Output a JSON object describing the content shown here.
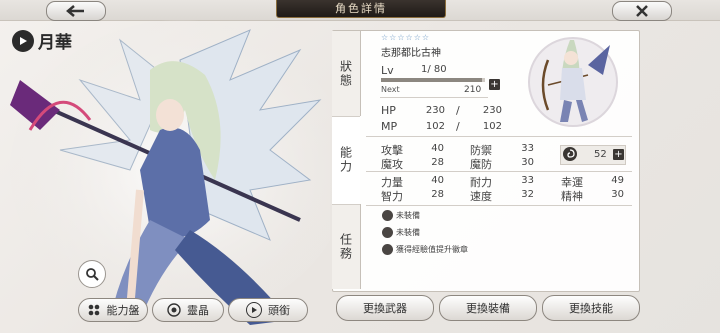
{
  "header": {
    "title": "角色詳情",
    "back_icon": "arrow-left-icon",
    "close_icon": "close-icon"
  },
  "character": {
    "name": "月華",
    "zoom_icon": "magnifier-icon"
  },
  "bottom_buttons": [
    {
      "label": "能力盤",
      "icon": "grid-icon"
    },
    {
      "label": "靈晶",
      "icon": "crystal-icon"
    },
    {
      "label": "頭銜",
      "icon": "title-icon"
    }
  ],
  "tabs": [
    {
      "label": "狀態",
      "active": false
    },
    {
      "label": "能力",
      "active": true
    },
    {
      "label": "任務",
      "active": false
    }
  ],
  "unit": {
    "stars": "☆☆☆☆☆☆",
    "name": "志那都比古神",
    "lv_label": "Lv",
    "lv_value": "1/ 80",
    "next_label": "Next",
    "next_value": "210",
    "xp_fraction": 0.97,
    "hp_label": "HP",
    "hp_cur": "230",
    "hp_sep": "/",
    "hp_max": "230",
    "mp_label": "MP",
    "mp_cur": "102",
    "mp_sep": "/",
    "mp_max": "102"
  },
  "stats": [
    {
      "label": "攻擊",
      "value": "40"
    },
    {
      "label": "防禦",
      "value": "33"
    },
    {
      "label": "魔攻",
      "value": "28"
    },
    {
      "label": "魔防",
      "value": "30"
    },
    {
      "label": "力量",
      "value": "40"
    },
    {
      "label": "耐力",
      "value": "33"
    },
    {
      "label": "幸運",
      "value": "49"
    },
    {
      "label": "智力",
      "value": "28"
    },
    {
      "label": "速度",
      "value": "32"
    },
    {
      "label": "精神",
      "value": "30"
    }
  ],
  "rune": {
    "value": "52",
    "icon": "swirl-icon"
  },
  "equipment": [
    {
      "label": "未裝備"
    },
    {
      "label": "未裝備"
    },
    {
      "label": "獲得經驗值提升徽章"
    }
  ],
  "actions": [
    {
      "label": "更換武器"
    },
    {
      "label": "更換裝備"
    },
    {
      "label": "更換技能"
    }
  ],
  "colors": {
    "accent_blue": "#6f9bc7",
    "dark_tab": "#1f1a17",
    "gold_trim": "#8a6d3c"
  }
}
